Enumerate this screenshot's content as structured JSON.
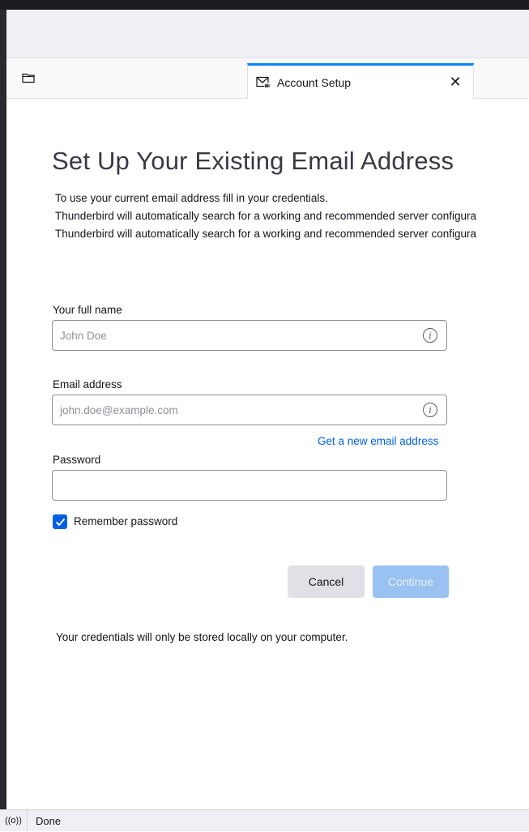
{
  "tab": {
    "title": "Account Setup",
    "close_symbol": "✕"
  },
  "form": {
    "heading": "Set Up Your Existing Email Address",
    "intro_lines": [
      "To use your current email address fill in your credentials.",
      "Thunderbird will automatically search for a working and recommended server configura",
      "Thunderbird will automatically search for a working and recommended server configura"
    ],
    "full_name": {
      "label": "Your full name",
      "placeholder": "John Doe",
      "value": ""
    },
    "email": {
      "label": "Email address",
      "placeholder": "john.doe@example.com",
      "value": ""
    },
    "get_new_address_link": "Get a new email address",
    "password": {
      "label": "Password",
      "value": ""
    },
    "remember_password": {
      "label": "Remember password",
      "checked": true
    },
    "cancel_label": "Cancel",
    "continue_label": "Continue",
    "note": "Your credentials will only be stored locally on your computer."
  },
  "status": {
    "icon_glyph": "((o))",
    "text": "Done"
  },
  "icons": {
    "tab_icon": "email-setup-icon",
    "folder": "folder-icon",
    "info": "info-icon",
    "status": "activity-icon"
  },
  "colors": {
    "accent": "#0a84ff",
    "link": "#0060df",
    "checkbox": "#0061e0",
    "continue_disabled": "#99c1f1"
  }
}
